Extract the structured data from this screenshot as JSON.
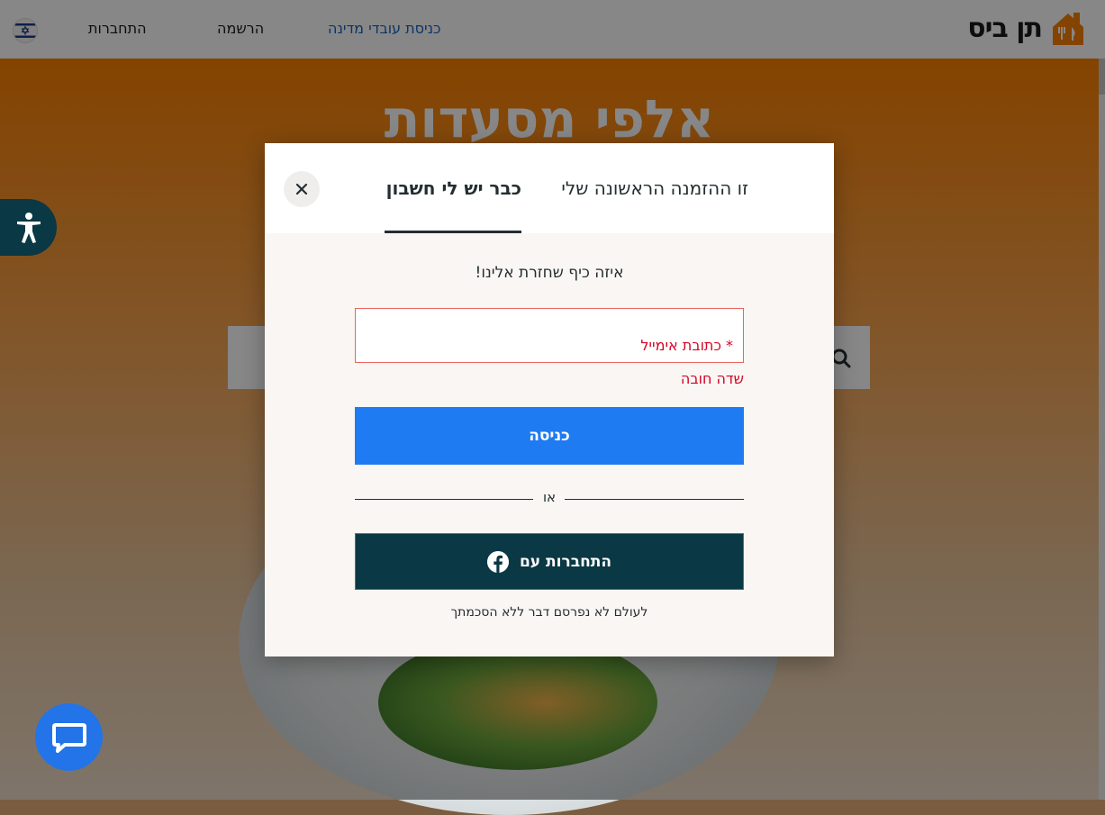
{
  "header": {
    "logo_text": "תן ביס",
    "nav": {
      "gov_login": "כניסת עובדי מדינה",
      "register": "הרשמה",
      "login": "התחברות"
    },
    "colors": {
      "logo": "#f97f00",
      "gov_link": "#1665c0"
    }
  },
  "hero": {
    "title": "אלפי מסעדות"
  },
  "modal": {
    "tabs": [
      {
        "label": "זו ההזמנה הראשונה שלי",
        "active": false
      },
      {
        "label": "כבר יש לי חשבון",
        "active": true
      }
    ],
    "close_icon": "close-icon",
    "welcome": "איזה כיף שחזרת אלינו!",
    "email": {
      "label": "* כתובת אימייל",
      "value": "",
      "error": "שדה חובה"
    },
    "login_button": "כניסה",
    "or": "או",
    "facebook_button": "התחברות עם",
    "facebook_icon": "facebook-icon",
    "privacy": "לעולם לא נפרסם דבר ללא הסכמתך",
    "colors": {
      "primary": "#1f7bf2",
      "dark": "#0a3844",
      "error": "#d50525"
    }
  },
  "widgets": {
    "accessibility_icon": "accessibility-icon",
    "chat_icon": "chat-icon"
  }
}
